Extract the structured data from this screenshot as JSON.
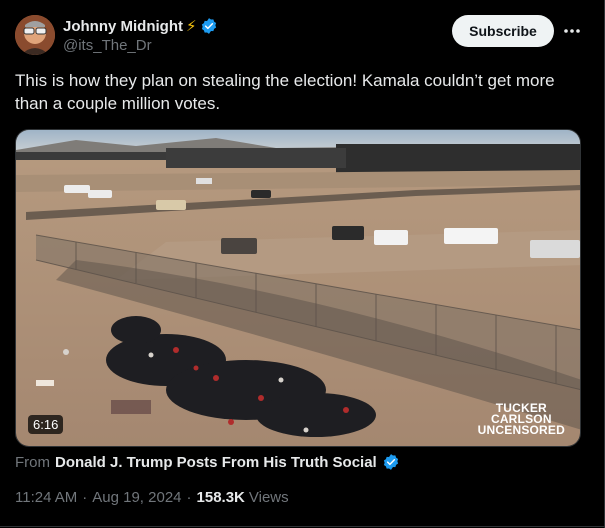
{
  "author": {
    "display_name": "Johnny Midnight",
    "handle": "@its_The_Dr",
    "badge_emoji": "⚡",
    "verified_color": "#1d9bf0"
  },
  "actions": {
    "subscribe_label": "Subscribe",
    "more_icon": "more-horizontal-icon"
  },
  "tweet": {
    "text": "This is how they plan on stealing the election! Kamala couldn’t get more than a couple million votes."
  },
  "media": {
    "duration": "6:16",
    "watermark": [
      "TUCKER",
      "CARLSON",
      "UNCENSORED"
    ]
  },
  "source": {
    "from_label": "From",
    "name": "Donald J. Trump Posts From His Truth Social"
  },
  "meta": {
    "time": "11:24 AM",
    "date": "Aug 19, 2024",
    "views_count": "158.3K",
    "views_label": "Views"
  },
  "colors": {
    "background": "#000000",
    "text": "#e7e9ea",
    "secondary": "#71767b",
    "accent": "#1d9bf0"
  }
}
